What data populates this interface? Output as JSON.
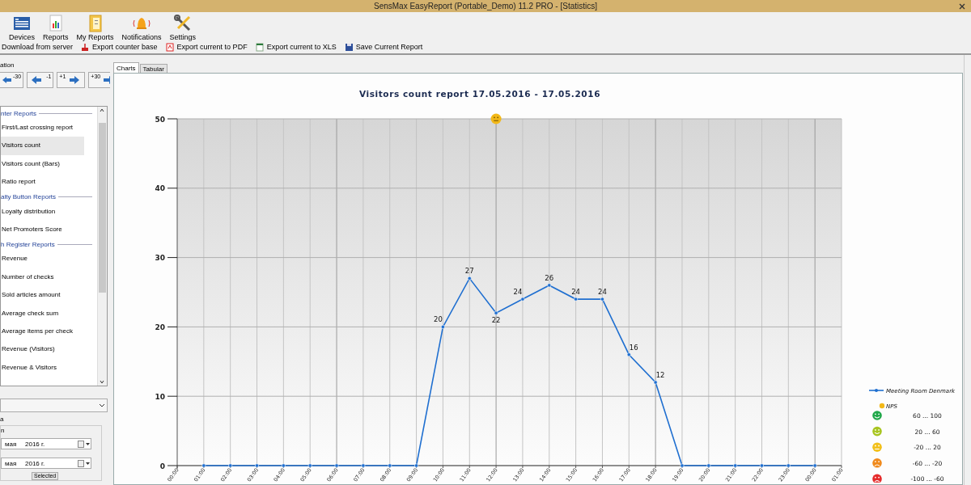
{
  "window": {
    "title": "SensMax EasyReport (Portable_Demo) 11.2 PRO - [Statistics]"
  },
  "ribbon": [
    {
      "label": "Devices",
      "kind": "devices"
    },
    {
      "label": "Reports",
      "kind": "reports"
    },
    {
      "label": "My Reports",
      "kind": "myreports"
    },
    {
      "label": "Notifications",
      "kind": "bell"
    },
    {
      "label": "Settings",
      "kind": "settings"
    }
  ],
  "toolbar": [
    {
      "label": "Download from server"
    },
    {
      "label": "Export counter base",
      "kind": "export"
    },
    {
      "label": "Export current to PDF",
      "kind": "pdf"
    },
    {
      "label": "Export current to XLS",
      "kind": "xls"
    },
    {
      "label": "Save Current Report",
      "kind": "save"
    }
  ],
  "sidebar": {
    "navigation_title": "ation",
    "nav_buttons": [
      {
        "label": "-30",
        "kind": "first"
      },
      {
        "label": "-1",
        "kind": "back"
      },
      {
        "label": "+1",
        "kind": "forward"
      },
      {
        "label": "+30",
        "kind": "last"
      }
    ],
    "report_groups": [
      {
        "title": "nter Reports",
        "items": [
          {
            "label": "First/Last crossing report",
            "selected": false
          },
          {
            "label": "Visitors count",
            "selected": true
          },
          {
            "label": "Visitors count (Bars)",
            "selected": false
          },
          {
            "label": "Ratio report",
            "selected": false
          }
        ]
      },
      {
        "title": "alty Button Reports",
        "items": [
          {
            "label": "Loyalty distribution",
            "selected": false
          },
          {
            "label": "Net Promoters Score",
            "selected": false
          }
        ]
      },
      {
        "title": "h Register Reports",
        "items": [
          {
            "label": "Revenue",
            "selected": false
          },
          {
            "label": "Number of checks",
            "selected": false
          },
          {
            "label": "Sold articles amount",
            "selected": false
          },
          {
            "label": "Average check sum",
            "selected": false
          },
          {
            "label": "Average items per check",
            "selected": false
          },
          {
            "label": "Revenue (Visitors)",
            "selected": false
          },
          {
            "label": "Revenue & Visitors",
            "selected": false
          }
        ]
      }
    ],
    "period_title": "a",
    "period_label": "n",
    "dates": [
      {
        "month": "мая",
        "year": "2016 г."
      },
      {
        "month": "мая",
        "year": "2016 г."
      }
    ],
    "bottom_tabs": [
      {
        "label": "Selected",
        "selected": false
      }
    ]
  },
  "tabs": [
    {
      "label": "Charts",
      "selected": true
    },
    {
      "label": "Tabular",
      "selected": false
    }
  ],
  "chart": {
    "chart_data": {
      "type": "line",
      "title": "Visitors count report 17.05.2016 - 17.05.2016",
      "categories": [
        "00:00",
        "01:00",
        "02:00",
        "03:00",
        "04:00",
        "05:00",
        "06:00",
        "07:00",
        "08:00",
        "09:00",
        "10:00",
        "11:00",
        "12:00",
        "13:00",
        "14:00",
        "15:00",
        "16:00",
        "17:00",
        "18:00",
        "19:00",
        "20:00",
        "21:00",
        "22:00",
        "23:00",
        "00:00",
        "01:00"
      ],
      "series": [
        {
          "name": "Meeting Room Denmark",
          "color": "#1f6fd0",
          "marker": "circle",
          "values": [
            null,
            0,
            0,
            0,
            0,
            0,
            0,
            0,
            0,
            0,
            20,
            27,
            22,
            24,
            26,
            24,
            24,
            16,
            12,
            0,
            0,
            0,
            0,
            0,
            0,
            null
          ],
          "value_labels": [
            null,
            null,
            null,
            null,
            null,
            null,
            null,
            null,
            null,
            null,
            "20",
            "27",
            "22",
            "24",
            "26",
            "24",
            "24",
            "16",
            "12",
            null,
            null,
            null,
            null,
            null,
            null,
            null
          ]
        },
        {
          "name": "NPS",
          "color": "#f2b818",
          "marker": "circle",
          "values": [
            null,
            null,
            null,
            null,
            null,
            null,
            null,
            null,
            null,
            null,
            null,
            null,
            50,
            null,
            null,
            null,
            null,
            null,
            null,
            null,
            null,
            null,
            null,
            null,
            null,
            null
          ]
        }
      ],
      "ylim": [
        0,
        50
      ],
      "yticks": [
        0,
        10,
        20,
        30,
        40,
        50
      ],
      "grid": true,
      "legend": "right"
    },
    "nps_legend": [
      {
        "range": "60 ... 100",
        "color": "#21a84a",
        "kind": "happy"
      },
      {
        "range": "20 ... 60",
        "color": "#a8c520",
        "kind": "happy"
      },
      {
        "range": "-20 ... 20",
        "color": "#f2c01a",
        "kind": "neutral"
      },
      {
        "range": "-60 ... -20",
        "color": "#f08a1c",
        "kind": "sad"
      },
      {
        "range": "-100 ... -60",
        "color": "#e52b2b",
        "kind": "sad"
      }
    ]
  }
}
